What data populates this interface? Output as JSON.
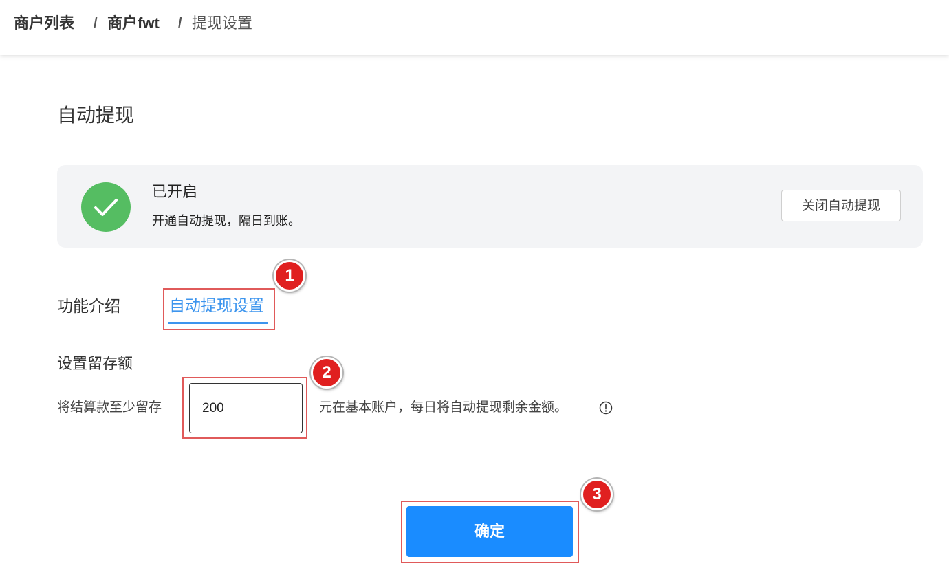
{
  "breadcrumb": {
    "items": [
      "商户列表",
      "商户fwt",
      "提现设置"
    ],
    "separator": "/"
  },
  "auto_withdraw": {
    "title": "自动提现",
    "status": {
      "icon": "check-icon",
      "title": "已开启",
      "description": "开通自动提现，隔日到账。",
      "close_button": "关闭自动提现"
    }
  },
  "tabs": [
    {
      "label": "功能介绍",
      "active": false
    },
    {
      "label": "自动提现设置",
      "active": true
    }
  ],
  "retain_settings": {
    "title": "设置留存额",
    "prefix": "将结算款至少留存",
    "value": "200",
    "suffix": "元在基本账户，每日将自动提现剩余金额。",
    "info_icon": "info-icon"
  },
  "confirm_button": "确定",
  "annotations": [
    "1",
    "2",
    "3"
  ],
  "colors": {
    "accent": "#1a8cff",
    "tab_active": "#3d95ee",
    "success": "#55bd62",
    "annotation": "#e02020"
  }
}
